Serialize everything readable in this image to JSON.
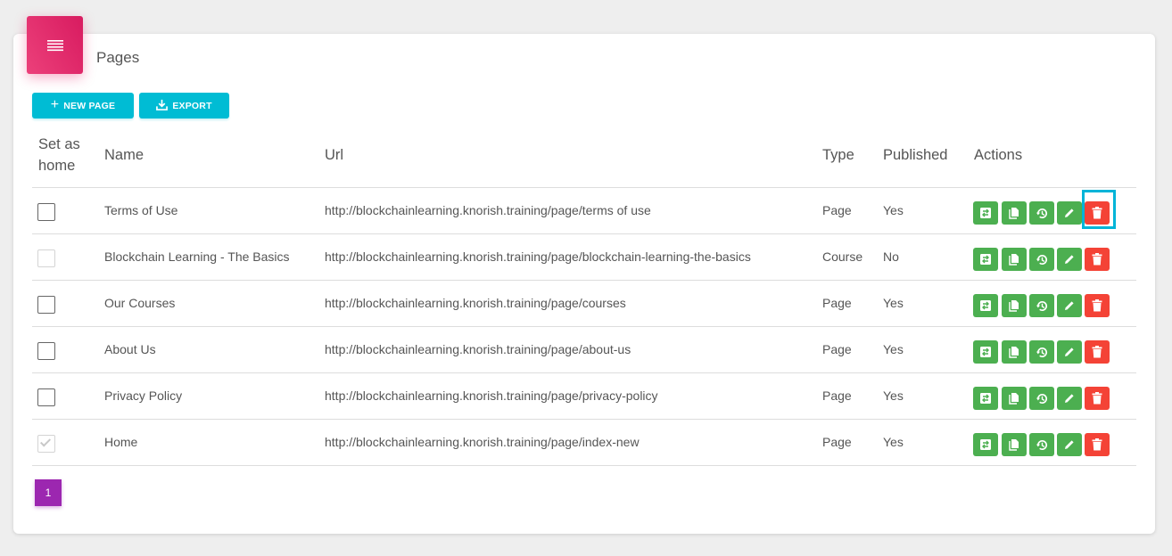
{
  "header": {
    "title": "Pages",
    "icon": "list-icon",
    "accent": "#e91e63"
  },
  "toolbar": {
    "new_page_label": "NEW PAGE",
    "export_label": "EXPORT",
    "button_color": "#00bcd4"
  },
  "table": {
    "columns": {
      "set_home_line1": "Set as",
      "set_home_line2": "home",
      "name": "Name",
      "url": "Url",
      "type": "Type",
      "published": "Published",
      "actions": "Actions"
    },
    "rows": [
      {
        "set_home": "unchecked",
        "name": "Terms of Use",
        "url": "http://blockchainlearning.knorish.training/page/terms of use",
        "type": "Page",
        "published": "Yes"
      },
      {
        "set_home": "disabled",
        "name": "Blockchain Learning - The Basics",
        "url": "http://blockchainlearning.knorish.training/page/blockchain-learning-the-basics",
        "type": "Course",
        "published": "No"
      },
      {
        "set_home": "unchecked",
        "name": "Our Courses",
        "url": "http://blockchainlearning.knorish.training/page/courses",
        "type": "Page",
        "published": "Yes"
      },
      {
        "set_home": "unchecked",
        "name": "About Us",
        "url": "http://blockchainlearning.knorish.training/page/about-us",
        "type": "Page",
        "published": "Yes"
      },
      {
        "set_home": "unchecked",
        "name": "Privacy Policy",
        "url": "http://blockchainlearning.knorish.training/page/privacy-policy",
        "type": "Page",
        "published": "Yes"
      },
      {
        "set_home": "checked-disabled",
        "name": "Home",
        "url": "http://blockchainlearning.knorish.training/page/index-new",
        "type": "Page",
        "published": "Yes"
      }
    ],
    "action_icons": [
      "swap-icon",
      "copy-icon",
      "history-icon",
      "edit-icon",
      "delete-icon"
    ],
    "action_color": "#4caf50",
    "delete_color": "#f44336"
  },
  "pagination": {
    "current_page": "1",
    "color": "#9c27b0"
  }
}
